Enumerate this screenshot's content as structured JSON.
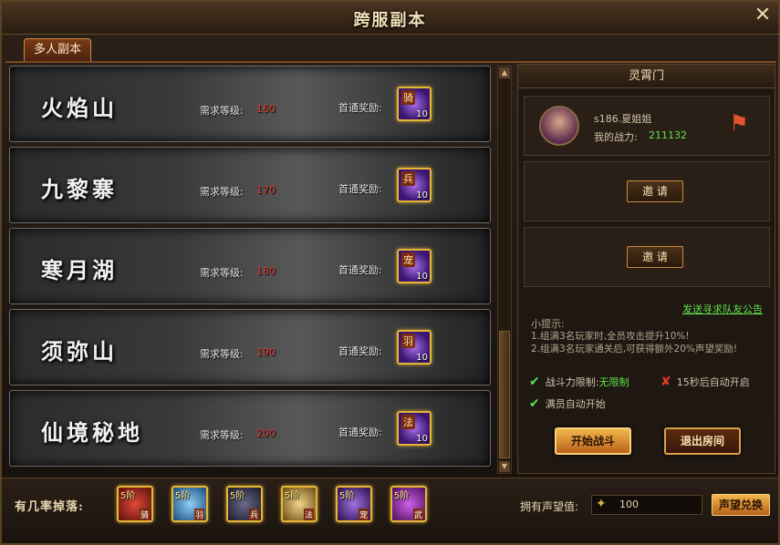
{
  "window": {
    "title": "跨服副本",
    "close_icon": "close-icon"
  },
  "tabs": [
    {
      "label": "多人副本",
      "active": true
    }
  ],
  "dungeons": [
    {
      "name": "火焰山",
      "level_label": "需求等级:",
      "level": "160",
      "reward_label": "首通奖励:",
      "reward_glyph": "骑",
      "reward_qty": "10"
    },
    {
      "name": "九黎寨",
      "level_label": "需求等级:",
      "level": "170",
      "reward_label": "首通奖励:",
      "reward_glyph": "兵",
      "reward_qty": "10"
    },
    {
      "name": "寒月湖",
      "level_label": "需求等级:",
      "level": "180",
      "reward_label": "首通奖励:",
      "reward_glyph": "宠",
      "reward_qty": "10"
    },
    {
      "name": "须弥山",
      "level_label": "需求等级:",
      "level": "190",
      "reward_label": "首通奖励:",
      "reward_glyph": "羽",
      "reward_qty": "10"
    },
    {
      "name": "仙境秘地",
      "level_label": "需求等级:",
      "level": "200",
      "reward_label": "首通奖励:",
      "reward_glyph": "法",
      "reward_qty": "10"
    }
  ],
  "room": {
    "title": "灵霄门",
    "player": {
      "name": "s186.夏姐姐",
      "power_label": "我的战力:",
      "power": "211132",
      "flag_icon": "flag-icon"
    },
    "invite_label": "邀 请",
    "announce_link": "发送寻求队友公告",
    "tips_title": "小提示:",
    "tips": [
      "1.组满3名玩家时,全员攻击提升10%!",
      "2.组满3名玩家通关后,可获得额外20%声望奖励!"
    ],
    "conditions": {
      "power_limit_label": "战斗力限制:",
      "power_limit_value": "无限制",
      "auto_start_timer": "15秒后自动开启",
      "auto_start_full": "满员自动开始"
    },
    "start_button": "开始战斗",
    "exit_button": "退出房间"
  },
  "drops": {
    "label": "有几率掉落:",
    "items": [
      {
        "tier": "5阶",
        "cls": "骑",
        "color": "#b0241a"
      },
      {
        "tier": "5阶",
        "cls": "羽",
        "color": "#3a8ac8"
      },
      {
        "tier": "5阶",
        "cls": "兵",
        "color": "#3a3a5a"
      },
      {
        "tier": "5阶",
        "cls": "法",
        "color": "#c8a03a"
      },
      {
        "tier": "5阶",
        "cls": "宠",
        "color": "#5a2a8a"
      },
      {
        "tier": "5阶",
        "cls": "武",
        "color": "#8a2aa8"
      }
    ]
  },
  "reputation": {
    "label": "拥有声望值:",
    "value": "100",
    "button": "声望兑换"
  }
}
